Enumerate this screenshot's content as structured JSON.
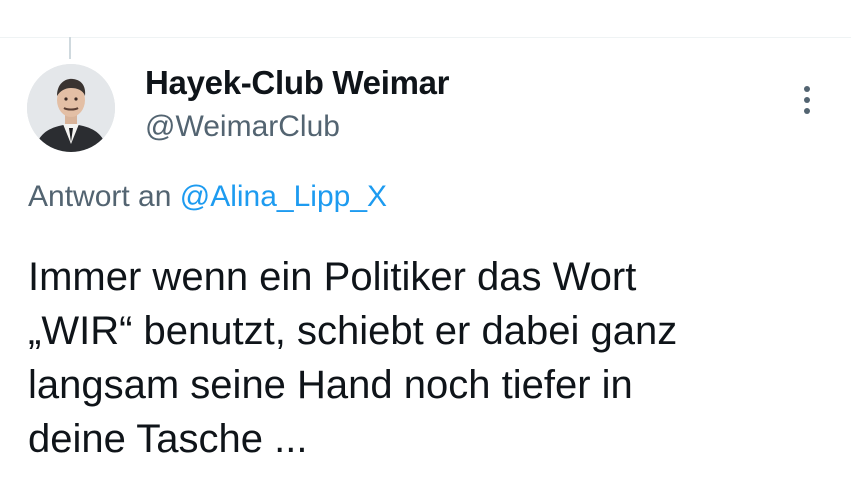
{
  "author": {
    "display_name": "Hayek-Club Weimar",
    "handle": "@WeimarClub",
    "avatar_icon": "portrait-photo"
  },
  "reply": {
    "prefix": "Antwort an ",
    "mention": "@Alina_Lipp_X"
  },
  "tweet": {
    "lines": [
      "Immer wenn ein Politiker das Wort",
      "„WIR“ benutzt, schiebt er dabei ganz",
      "langsam seine Hand noch tiefer in",
      "deine Tasche ..."
    ]
  },
  "icons": {
    "more": "more-options-icon"
  },
  "colors": {
    "text_primary": "#0f1419",
    "text_secondary": "#536471",
    "link": "#1d9bf0",
    "divider": "#eff3f4"
  }
}
